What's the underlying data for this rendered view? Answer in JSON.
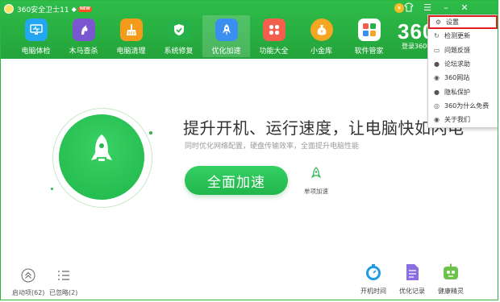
{
  "window": {
    "title": "360安全卫士11",
    "new_badge": "NEW",
    "brand": "360",
    "brand_sub": "登录360帐号"
  },
  "nav": {
    "items": [
      {
        "label": "电脑体检",
        "icon": "monitor-check-icon",
        "color": "#22a7f0"
      },
      {
        "label": "木马查杀",
        "icon": "horse-shield-icon",
        "color": "#7a57d1"
      },
      {
        "label": "电脑清理",
        "icon": "broom-icon",
        "color": "#f59b1b"
      },
      {
        "label": "系统修复",
        "icon": "shield-check-icon",
        "color": "#27b14a"
      },
      {
        "label": "优化加速",
        "icon": "rocket-icon",
        "color": "#3a8ff0"
      },
      {
        "label": "功能大全",
        "icon": "grid-icon",
        "color": "#f45f4d"
      },
      {
        "label": "小金库",
        "icon": "money-bag-icon",
        "color": "#f5a623"
      },
      {
        "label": "软件管家",
        "icon": "app-store-icon",
        "color": "#ff7a45"
      }
    ],
    "active_index": 4
  },
  "main": {
    "headline": "提升开机、运行速度，让电脑快如闪电",
    "subline": "同时优化网络配置，硬盘传输效率，全面提升电脑性能",
    "boost_button": "全面加速",
    "single_boost": "单项加速"
  },
  "bottom_left": {
    "startup": "启动项(62)",
    "ignored": "已忽略(2)"
  },
  "bottom_right": {
    "boot_time": "开机时间",
    "opt_record": "优化记录",
    "health": "健康精灵"
  },
  "menu": {
    "items": [
      {
        "label": "设置",
        "icon": "gear-icon"
      },
      {
        "label": "检测更新",
        "icon": "refresh-icon"
      },
      {
        "label": "问题反馈",
        "icon": "feedback-icon"
      },
      {
        "label": "论坛求助",
        "icon": "chat-icon"
      },
      {
        "label": "360网站",
        "icon": "globe-icon"
      },
      {
        "label": "隐私保护",
        "icon": "privacy-icon"
      },
      {
        "label": "360为什么免费",
        "icon": "question-icon"
      },
      {
        "label": "关于我们",
        "icon": "info-icon"
      }
    ],
    "highlighted_index": 0
  }
}
